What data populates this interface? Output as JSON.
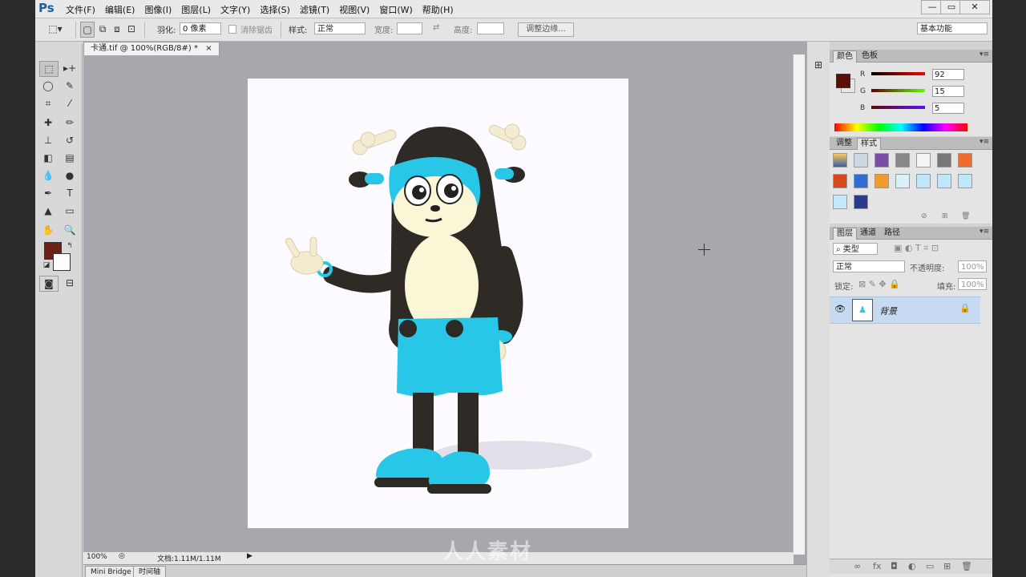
{
  "app": {
    "logo": "Ps",
    "menu": [
      "文件(F)",
      "编辑(E)",
      "图像(I)",
      "图层(L)",
      "文字(Y)",
      "选择(S)",
      "滤镜(T)",
      "视图(V)",
      "窗口(W)",
      "帮助(H)"
    ],
    "window_controls": [
      "—",
      "▭",
      "✕"
    ]
  },
  "options": {
    "feather_label": "羽化:",
    "feather_value": "0 像素",
    "antialias_label": "消除锯齿",
    "style_label": "样式:",
    "style_value": "正常",
    "width_label": "宽度:",
    "height_label": "高度:",
    "refine_edge": "调整边缘...",
    "workspace": "基本功能"
  },
  "document": {
    "tab_title": "卡通.tif @ 100%(RGB/8#) *",
    "zoom": "100%",
    "doc_size": "文档:1.11M/1.11M"
  },
  "bottom_tabs": [
    "Mini Bridge",
    "时间轴"
  ],
  "color_panel": {
    "tabs": [
      "颜色",
      "色板"
    ],
    "fg_color": "#5c0f05",
    "channels": [
      {
        "label": "R",
        "value": "92"
      },
      {
        "label": "G",
        "value": "15"
      },
      {
        "label": "B",
        "value": "5"
      }
    ]
  },
  "adjust_panel": {
    "tabs": [
      "调整",
      "样式"
    ]
  },
  "layers_panel": {
    "tabs": [
      "图层",
      "通道",
      "路径"
    ],
    "filter_kind": "类型",
    "blend_mode": "正常",
    "opacity_label": "不透明度:",
    "opacity_value": "100%",
    "lock_label": "锁定:",
    "fill_label": "填充:",
    "fill_value": "100%",
    "layer_name": "背景"
  },
  "watermark": "人人素材"
}
